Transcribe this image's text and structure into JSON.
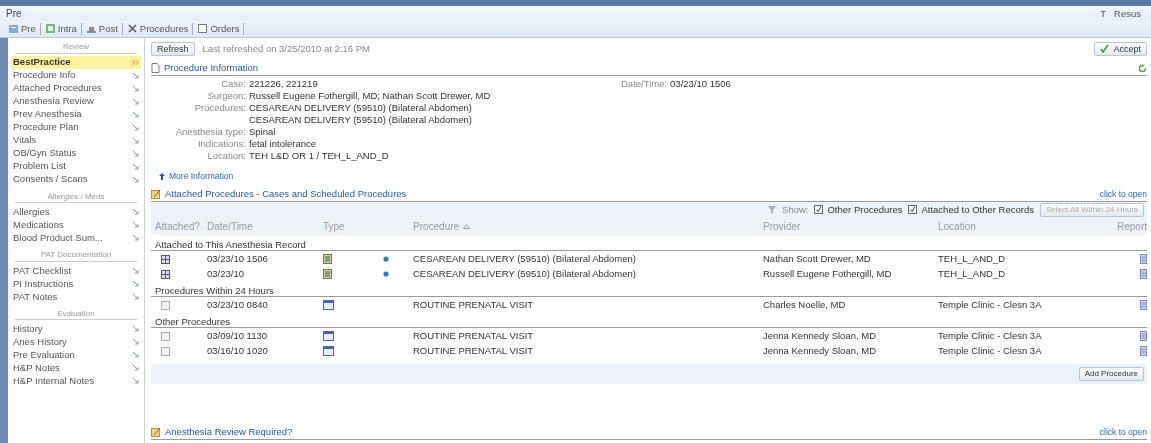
{
  "window": {
    "title": "Pre",
    "right_buttons": [
      "T",
      "Resus"
    ]
  },
  "toolbar": [
    {
      "label": "Pre",
      "kind": "pre"
    },
    {
      "label": "Intra",
      "kind": "intra"
    },
    {
      "label": "Post",
      "kind": "post"
    },
    {
      "label": "Procedures",
      "kind": "procedures"
    },
    {
      "label": "Orders",
      "kind": "orders"
    }
  ],
  "sidebar": {
    "groups": [
      {
        "title": "Review",
        "items": [
          {
            "label": "BestPractice",
            "selected": true
          },
          {
            "label": "Procedure Info",
            "selected": false
          },
          {
            "label": "Attached Procedures",
            "selected": false
          },
          {
            "label": "Anesthesia Review",
            "selected": false
          },
          {
            "label": "Prev Anesthesia",
            "selected": false
          },
          {
            "label": "Procedure Plan",
            "selected": false
          },
          {
            "label": "Vitals",
            "selected": false
          },
          {
            "label": "OB/Gyn Status",
            "selected": false
          },
          {
            "label": "Problem List",
            "selected": false
          },
          {
            "label": "Consents / Scans",
            "selected": false
          }
        ]
      },
      {
        "title": "Allergies / Meds",
        "items": [
          {
            "label": "Allergies",
            "selected": false
          },
          {
            "label": "Medications",
            "selected": false
          },
          {
            "label": "Blood Product Sum...",
            "selected": false
          }
        ]
      },
      {
        "title": "PAT Documentation",
        "items": [
          {
            "label": "PAT Checklist",
            "selected": false
          },
          {
            "label": "PI Instructions",
            "selected": false
          },
          {
            "label": "PAT Notes",
            "selected": false
          }
        ]
      },
      {
        "title": "Evaluation",
        "items": [
          {
            "label": "History",
            "selected": false
          },
          {
            "label": "Anes History",
            "selected": false
          },
          {
            "label": "Pre Evaluation",
            "selected": false
          },
          {
            "label": "H&P Notes",
            "selected": false
          },
          {
            "label": "H&P Internal Notes",
            "selected": false
          }
        ]
      }
    ]
  },
  "refresh": {
    "button": "Refresh",
    "note": "Last refreshed on 3/25/2010 at 2:16 PM"
  },
  "accept_button": "Accept",
  "procedure_information": {
    "title": "Procedure Information",
    "fields": [
      {
        "label": "Case:",
        "values": [
          "221226, 221219"
        ]
      },
      {
        "label": "Surgeon:",
        "values": [
          "Russell Eugene Fothergill, MD; Nathan Scott Drewer, MD"
        ]
      },
      {
        "label": "Procedures:",
        "values": [
          "CESAREAN DELIVERY (59510) (Bilateral Abdomen)",
          "CESAREAN DELIVERY (59510) (Bilateral Abdomen)"
        ]
      },
      {
        "label": "Anesthesia type:",
        "values": [
          "Spinal"
        ]
      },
      {
        "label": "Indications:",
        "values": [
          "fetal intolerance"
        ]
      },
      {
        "label": "Location:",
        "values": [
          "TEH L&D OR 1 / TEH_L_AND_D"
        ]
      }
    ],
    "date_time": {
      "label": "Date/Time:",
      "value": "03/23/10 1506"
    },
    "more_link": "More Information"
  },
  "attached_procedures": {
    "title": "Attached Procedures - Cases and Scheduled Procedures",
    "toggle": "click to open",
    "filters": {
      "label": "Show:",
      "options": [
        {
          "label": "Other Procedures",
          "checked": true
        },
        {
          "label": "Attached to Other Records",
          "checked": true
        }
      ],
      "select_button": {
        "label": "Select All Within 24 Hours",
        "disabled": true
      }
    },
    "columns": [
      "Attached?",
      "Date/Time",
      "Type",
      "Procedure",
      "Provider",
      "Location",
      "Report"
    ],
    "groups": [
      {
        "title": "Attached to This Anesthesia Record",
        "rows": [
          {
            "checked": true,
            "date_time": "03/23/10 1506",
            "kind": "case",
            "procedure": "CESAREAN DELIVERY (59510) (Bilateral Abdomen)",
            "provider": "Nathan Scott Drewer, MD",
            "location": "TEH_L_AND_D"
          },
          {
            "checked": true,
            "date_time": "03/23/10",
            "kind": "case",
            "procedure": "CESAREAN DELIVERY (59510) (Bilateral Abdomen)",
            "provider": "Russell Eugene Fothergill, MD",
            "location": "TEH_L_AND_D"
          }
        ]
      },
      {
        "title": "Procedures Within 24 Hours",
        "rows": [
          {
            "checked": false,
            "date_time": "03/23/10 0840",
            "kind": "scheduled",
            "procedure": "ROUTINE PRENATAL VISIT",
            "provider": "Charles Noelle, MD",
            "location": "Temple Clinic - Clesn 3A"
          }
        ]
      },
      {
        "title": "Other Procedures",
        "rows": [
          {
            "checked": false,
            "date_time": "03/09/10 1130",
            "kind": "scheduled",
            "procedure": "ROUTINE PRENATAL VISIT",
            "provider": "Jenna Kennedy Sloan, MD",
            "location": "Temple Clinic - Clesn 3A"
          },
          {
            "checked": false,
            "date_time": "03/16/10 1020",
            "kind": "scheduled",
            "procedure": "ROUTINE PRENATAL VISIT",
            "provider": "Jenna Kennedy Sloan, MD",
            "location": "Temple Clinic - Clesn 3A"
          }
        ]
      }
    ],
    "add_button": "Add Procedure"
  },
  "review_section": {
    "title": "Anesthesia Review Required?",
    "toggle": "click to open"
  }
}
